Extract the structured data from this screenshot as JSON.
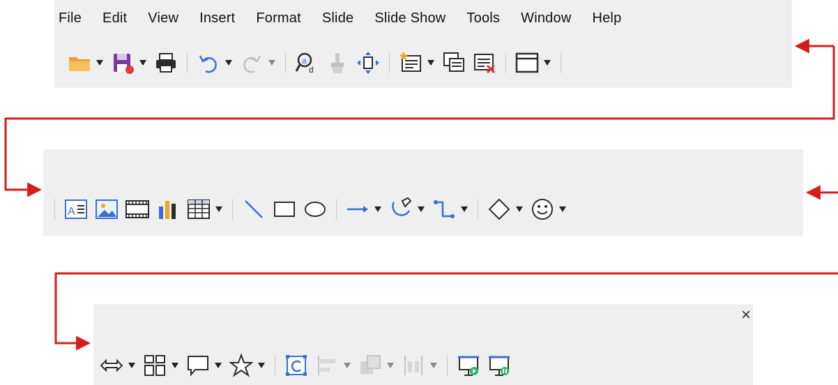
{
  "menu": [
    "File",
    "Edit",
    "View",
    "Insert",
    "Format",
    "Slide",
    "Slide Show",
    "Tools",
    "Window",
    "Help"
  ],
  "close_glyph": "×",
  "colors": {
    "panel_bg": "#efefef",
    "connector_red": "#d61d1d",
    "icon_blue": "#3b6fd0",
    "icon_dark": "#2c2c2c",
    "folder_orange": "#f0a030",
    "save_purple": "#7a3aa0",
    "accent_green": "#2bb673"
  },
  "toolbar_1": [
    {
      "icon": "open-folder-icon",
      "dropdown": true
    },
    {
      "icon": "save-icon",
      "dropdown": true
    },
    {
      "icon": "print-icon",
      "dropdown": false
    },
    {
      "sep": true
    },
    {
      "icon": "undo-icon",
      "dropdown": true
    },
    {
      "icon": "redo-icon",
      "dropdown": true,
      "disabled": true
    },
    {
      "sep": true
    },
    {
      "icon": "find-replace-icon",
      "dropdown": false
    },
    {
      "icon": "clone-formatting-icon",
      "dropdown": false,
      "disabled": true
    },
    {
      "icon": "navigate-icon",
      "dropdown": false
    },
    {
      "sep": true
    },
    {
      "icon": "new-slide-icon",
      "dropdown": true
    },
    {
      "icon": "duplicate-slide-icon",
      "dropdown": false
    },
    {
      "icon": "delete-slide-icon",
      "dropdown": false
    },
    {
      "sep": true
    },
    {
      "icon": "slide-layout-icon",
      "dropdown": true
    },
    {
      "sep": true
    }
  ],
  "toolbar_2": [
    {
      "sep": true
    },
    {
      "icon": "text-box-icon",
      "dropdown": false
    },
    {
      "icon": "image-icon",
      "dropdown": false
    },
    {
      "icon": "media-icon",
      "dropdown": false
    },
    {
      "icon": "chart-icon",
      "dropdown": false
    },
    {
      "icon": "table-icon",
      "dropdown": true
    },
    {
      "sep": true
    },
    {
      "icon": "line-icon",
      "dropdown": false
    },
    {
      "icon": "rectangle-icon",
      "dropdown": false
    },
    {
      "icon": "ellipse-icon",
      "dropdown": false
    },
    {
      "sep": true
    },
    {
      "icon": "arrow-line-icon",
      "dropdown": true
    },
    {
      "icon": "curve-icon",
      "dropdown": true
    },
    {
      "icon": "connector-icon",
      "dropdown": true
    },
    {
      "sep": true
    },
    {
      "icon": "basic-shapes-icon",
      "dropdown": true
    },
    {
      "icon": "symbol-shapes-icon",
      "dropdown": true
    }
  ],
  "toolbar_3": [
    {
      "icon": "block-arrows-icon",
      "dropdown": true
    },
    {
      "icon": "flowchart-icon",
      "dropdown": true
    },
    {
      "icon": "callout-icon",
      "dropdown": true
    },
    {
      "icon": "stars-icon",
      "dropdown": true
    },
    {
      "sep": true
    },
    {
      "icon": "rotate-icon",
      "dropdown": false
    },
    {
      "icon": "align-icon",
      "dropdown": true,
      "disabled": true
    },
    {
      "icon": "arrange-icon",
      "dropdown": true,
      "disabled": true
    },
    {
      "icon": "distribute-icon",
      "dropdown": true,
      "disabled": true
    },
    {
      "sep": true
    },
    {
      "icon": "start-from-first-icon",
      "dropdown": false
    },
    {
      "icon": "start-from-current-icon",
      "dropdown": false
    }
  ]
}
